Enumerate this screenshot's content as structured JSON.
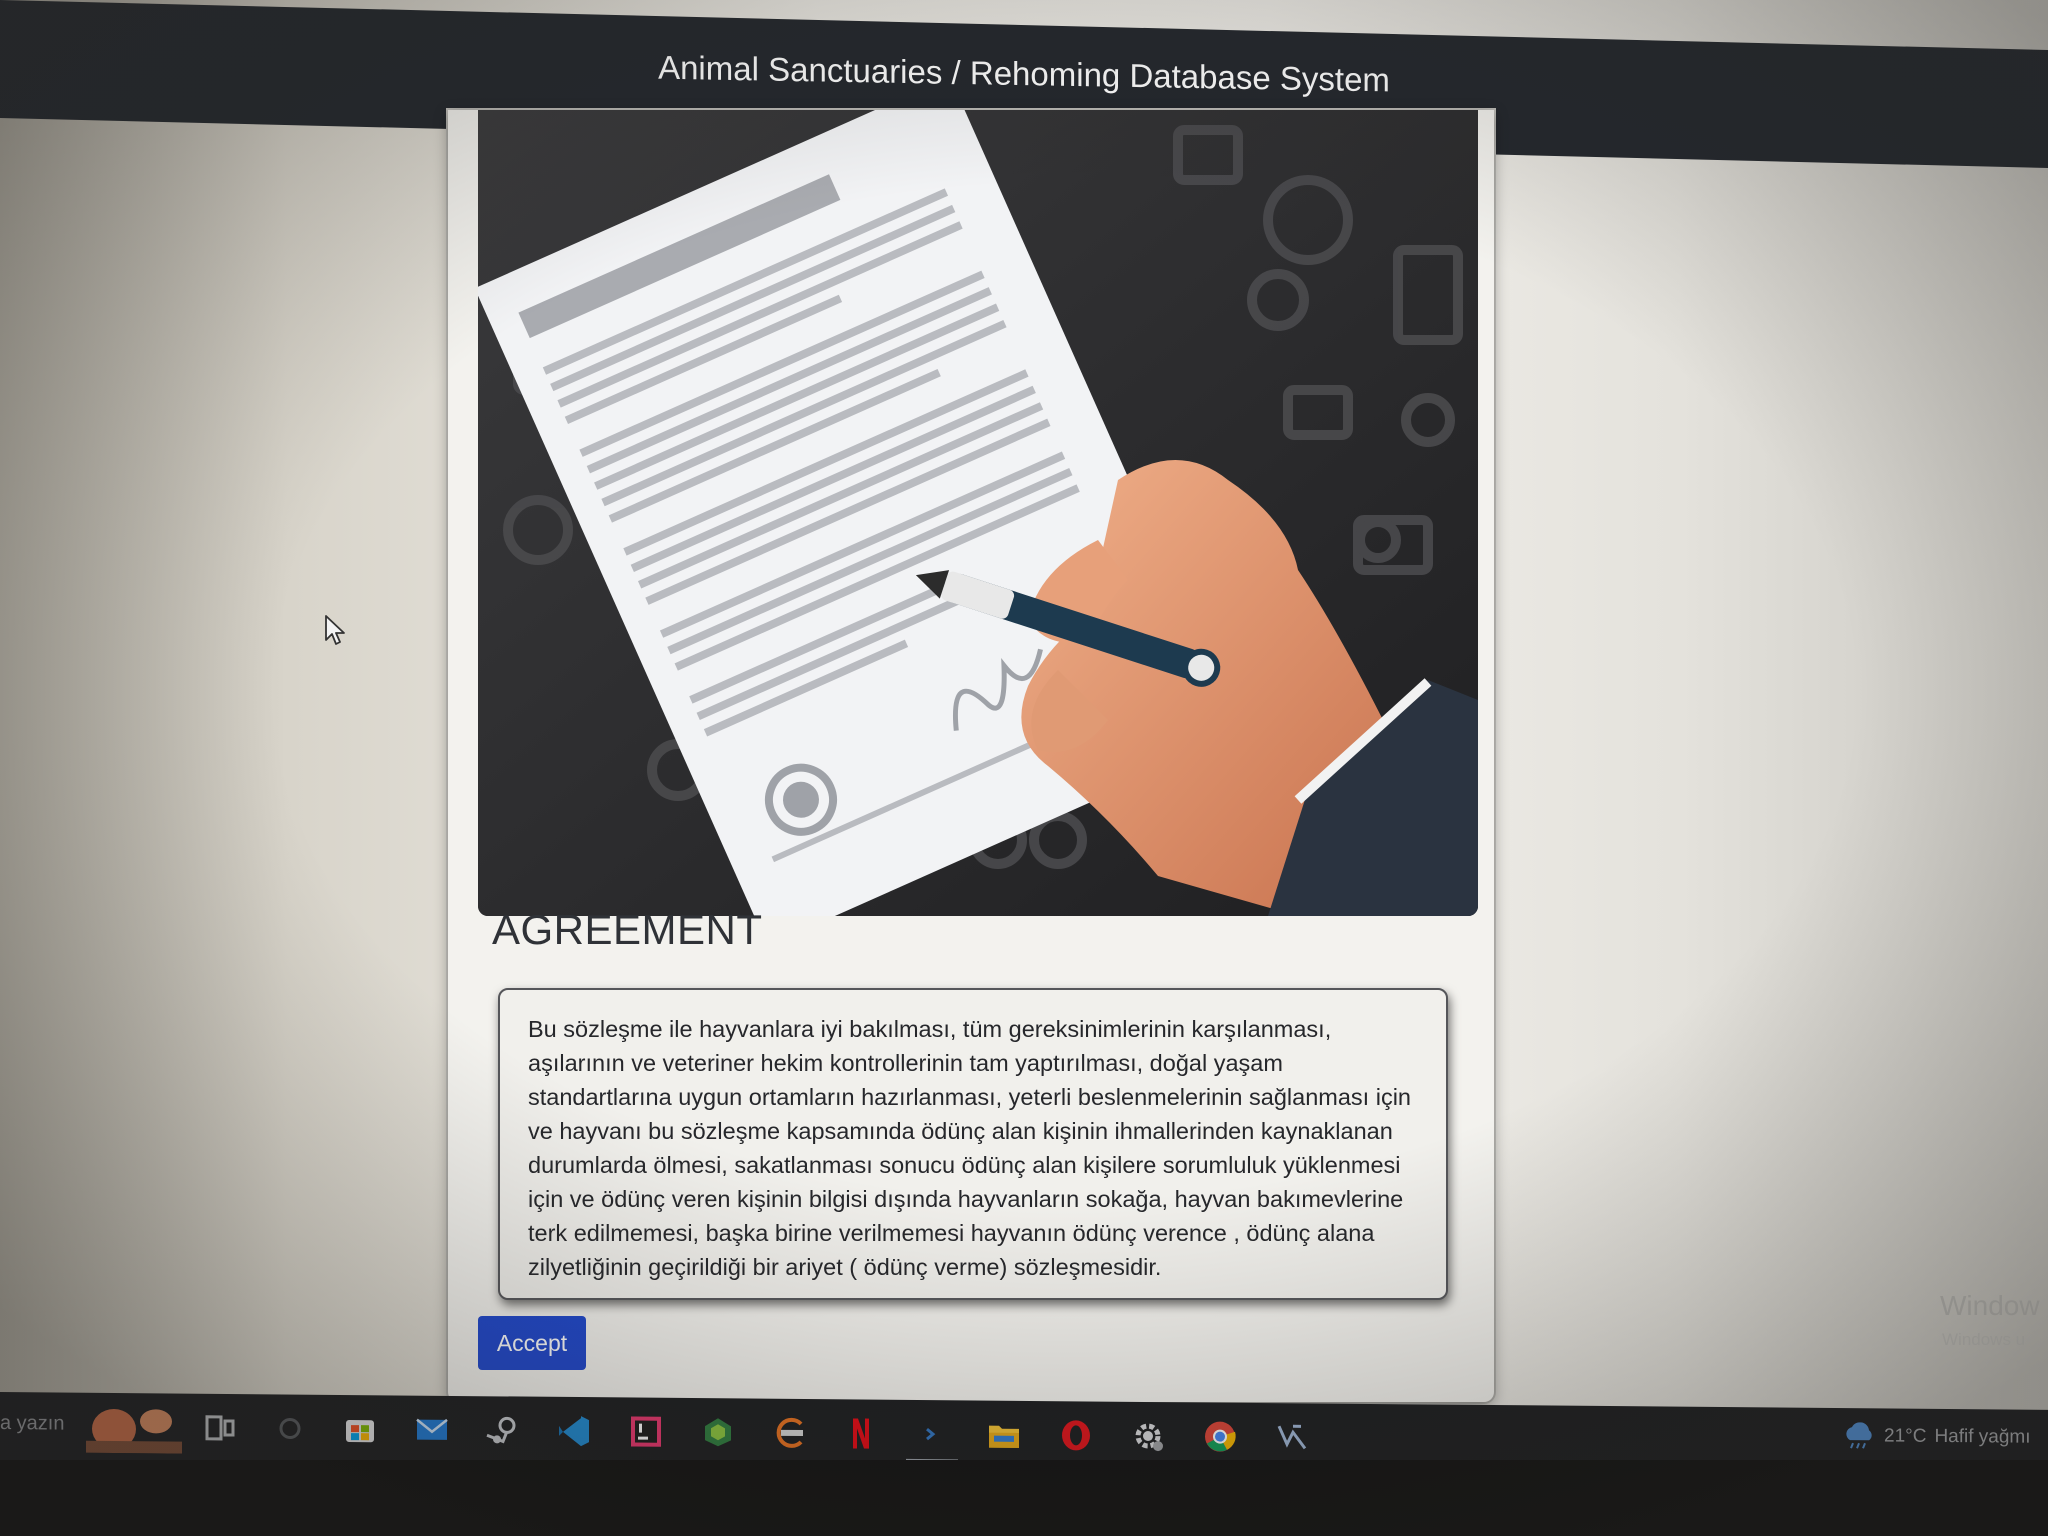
{
  "header": {
    "title": "Animal Sanctuaries / Rehoming Database System"
  },
  "agreement": {
    "heading": "AGREEMENT",
    "text": "Bu sözleşme ile hayvanlara iyi bakılması, tüm gereksinimlerinin karşılanması, aşılarının ve veteriner hekim kontrollerinin tam yaptırılması, doğal yaşam standartlarına uygun ortamların hazırlanması, yeterli beslenmelerinin sağlanması için ve hayvanı bu sözleşme kapsamında ödünç alan kişinin ihmallerinden kaynaklanan durumlarda ölmesi, sakatlanması sonucu ödünç alan kişilere sorumluluk yüklenmesi için ve ödünç veren kişinin bilgisi dışında hayvanların sokağa, hayvan bakımevlerine terk edilmemesi, başka birine verilmemesi hayvanın ödünç verence , ödünç alana zilyetliğinin geçirildiği bir ariyet ( ödünç verme) sözleşmesidir.",
    "accept_label": "Accept"
  },
  "watermark": {
    "line1": "Window",
    "line2": "Windows u"
  },
  "taskbar": {
    "search_hint": "a yazın",
    "icons": [
      "task-view-icon",
      "cortana-icon",
      "store-icon",
      "mail-icon",
      "steam-icon",
      "vscode-icon",
      "intellij-icon",
      "gpu-app-icon",
      "app-icon",
      "netflix-icon",
      "powershell-icon",
      "file-explorer-icon",
      "opera-icon",
      "settings-icon",
      "chrome-icon",
      "unity-icon"
    ],
    "weather": {
      "temperature": "21°C",
      "condition": "Hafif yağmı"
    }
  },
  "colors": {
    "accept_button": "#1f47cc",
    "topbar": "#23272d",
    "taskbar": "#1c1d20"
  }
}
